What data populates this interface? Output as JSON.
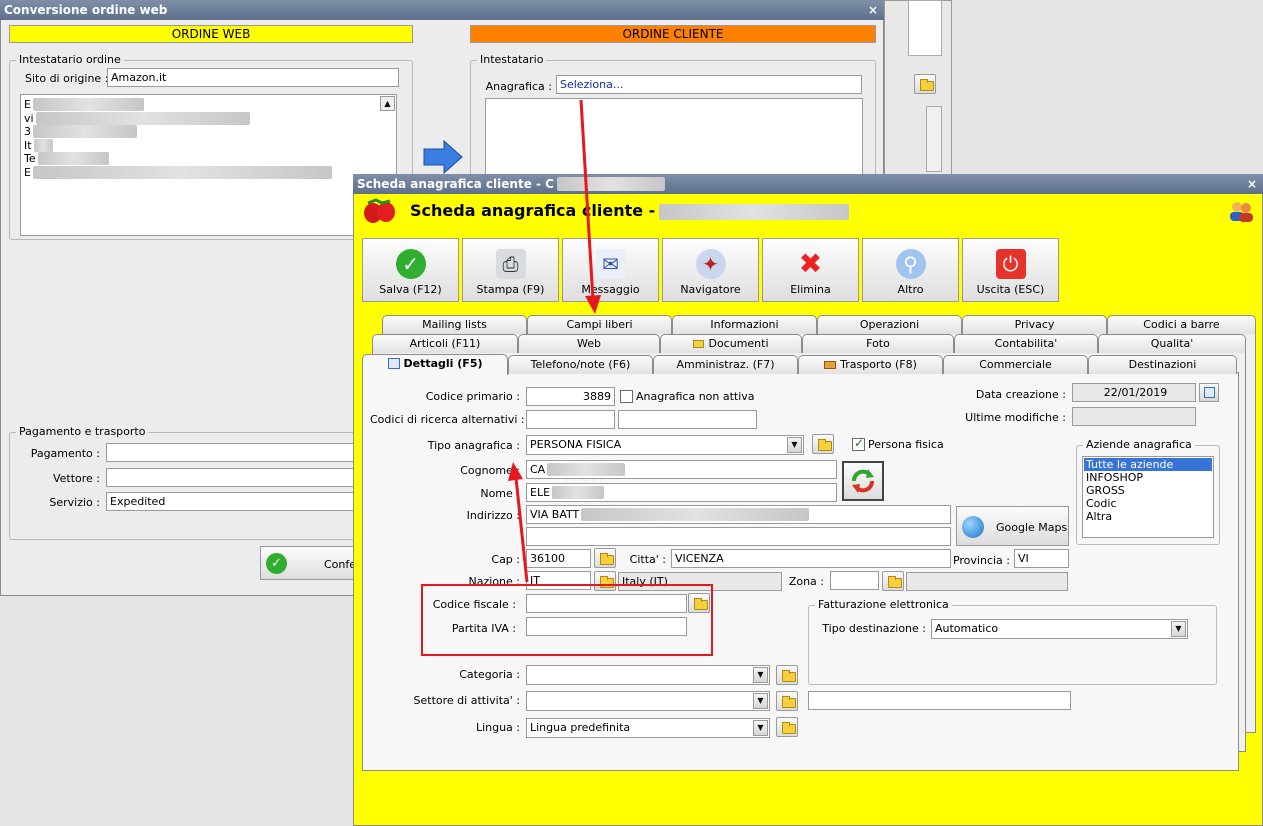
{
  "back_window": {
    "title": "Conversione ordine web",
    "close": "×",
    "ordine_web": "ORDINE WEB",
    "ordine_cliente": "ORDINE CLIENTE",
    "intestatario_ordine": "Intestatario ordine",
    "sito_label": "Sito di origine :",
    "sito_value": "Amazon.it",
    "address_lines": [
      "E",
      "vi",
      "3",
      "It",
      "Te",
      "E"
    ],
    "intestatario": "Intestatario",
    "anagrafica_label": "Anagrafica :",
    "anagrafica_value": "Seleziona...",
    "pagamento_trasporto": "Pagamento e trasporto",
    "pagamento_label": "Pagamento :",
    "vettore_label": "Vettore :",
    "servizio_label": "Servizio :",
    "servizio_value": "Expedited",
    "confirm_label": "Confe"
  },
  "front_window": {
    "title": "Scheda anagrafica cliente - C",
    "close": "×",
    "header_title": "Scheda anagrafica cliente -",
    "toolbar": [
      {
        "label": "Salva (F12)",
        "icon": "check-icon"
      },
      {
        "label": "Stampa (F9)",
        "icon": "printer-icon"
      },
      {
        "label": "Messaggio",
        "icon": "message-icon"
      },
      {
        "label": "Navigatore",
        "icon": "compass-icon"
      },
      {
        "label": "Elimina",
        "icon": "delete-icon"
      },
      {
        "label": "Altro",
        "icon": "search-icon"
      },
      {
        "label": "Uscita (ESC)",
        "icon": "power-icon"
      }
    ],
    "tabs_row1": [
      "Mailing lists",
      "Campi liberi",
      "Informazioni",
      "Operazioni",
      "Privacy",
      "Codici a barre"
    ],
    "tabs_row2": [
      "Articoli (F11)",
      "Web",
      "Documenti",
      "Foto",
      "Contabilita'",
      "Qualita'"
    ],
    "tabs_row3": [
      "Dettagli (F5)",
      "Telefono/note (F6)",
      "Amministraz. (F7)",
      "Trasporto (F8)",
      "Commerciale",
      "Destinazioni"
    ],
    "form": {
      "codice_primario_label": "Codice primario :",
      "codice_primario_value": "3889",
      "anagrafica_non_attiva": "Anagrafica non attiva",
      "codici_ricerca_label": "Codici di ricerca alternativi :",
      "tipo_anagrafica_label": "Tipo anagrafica :",
      "tipo_anagrafica_value": "PERSONA FISICA",
      "persona_fisica": "Persona fisica",
      "cognome_label": "Cognome :",
      "cognome_value": "CA",
      "nome_label": "Nome :",
      "nome_value": "ELE",
      "indirizzo_label": "Indirizzo :",
      "indirizzo_value": "VIA BATT",
      "google_maps": "Google Maps",
      "cap_label": "Cap :",
      "cap_value": "36100",
      "citta_label": "Citta' :",
      "citta_value": "VICENZA",
      "provincia_label": "Provincia :",
      "provincia_value": "VI",
      "nazione_label": "Nazione :",
      "nazione_value": "IT",
      "nazione_desc": "Italy (IT)",
      "zona_label": "Zona :",
      "codice_fiscale_label": "Codice fiscale :",
      "partita_iva_label": "Partita IVA :",
      "fatturazione_label": "Fatturazione elettronica",
      "tipo_destinazione_label": "Tipo destinazione :",
      "tipo_destinazione_value": "Automatico",
      "categoria_label": "Categoria :",
      "settore_label": "Settore di attivita' :",
      "lingua_label": "Lingua :",
      "lingua_value": "Lingua predefinita",
      "data_creazione_label": "Data creazione :",
      "data_creazione_value": "22/01/2019",
      "ultime_modifiche_label": "Ultime modifiche :",
      "aziende_label": "Aziende anagrafica",
      "aziende": [
        "Tutte le aziende",
        "INFOSHOP",
        "GROSS",
        "Codic",
        "Altra"
      ]
    }
  },
  "colors": {
    "yellow": "#ffff00",
    "orange": "#ff8000",
    "red_annotation": "#e5191d"
  }
}
